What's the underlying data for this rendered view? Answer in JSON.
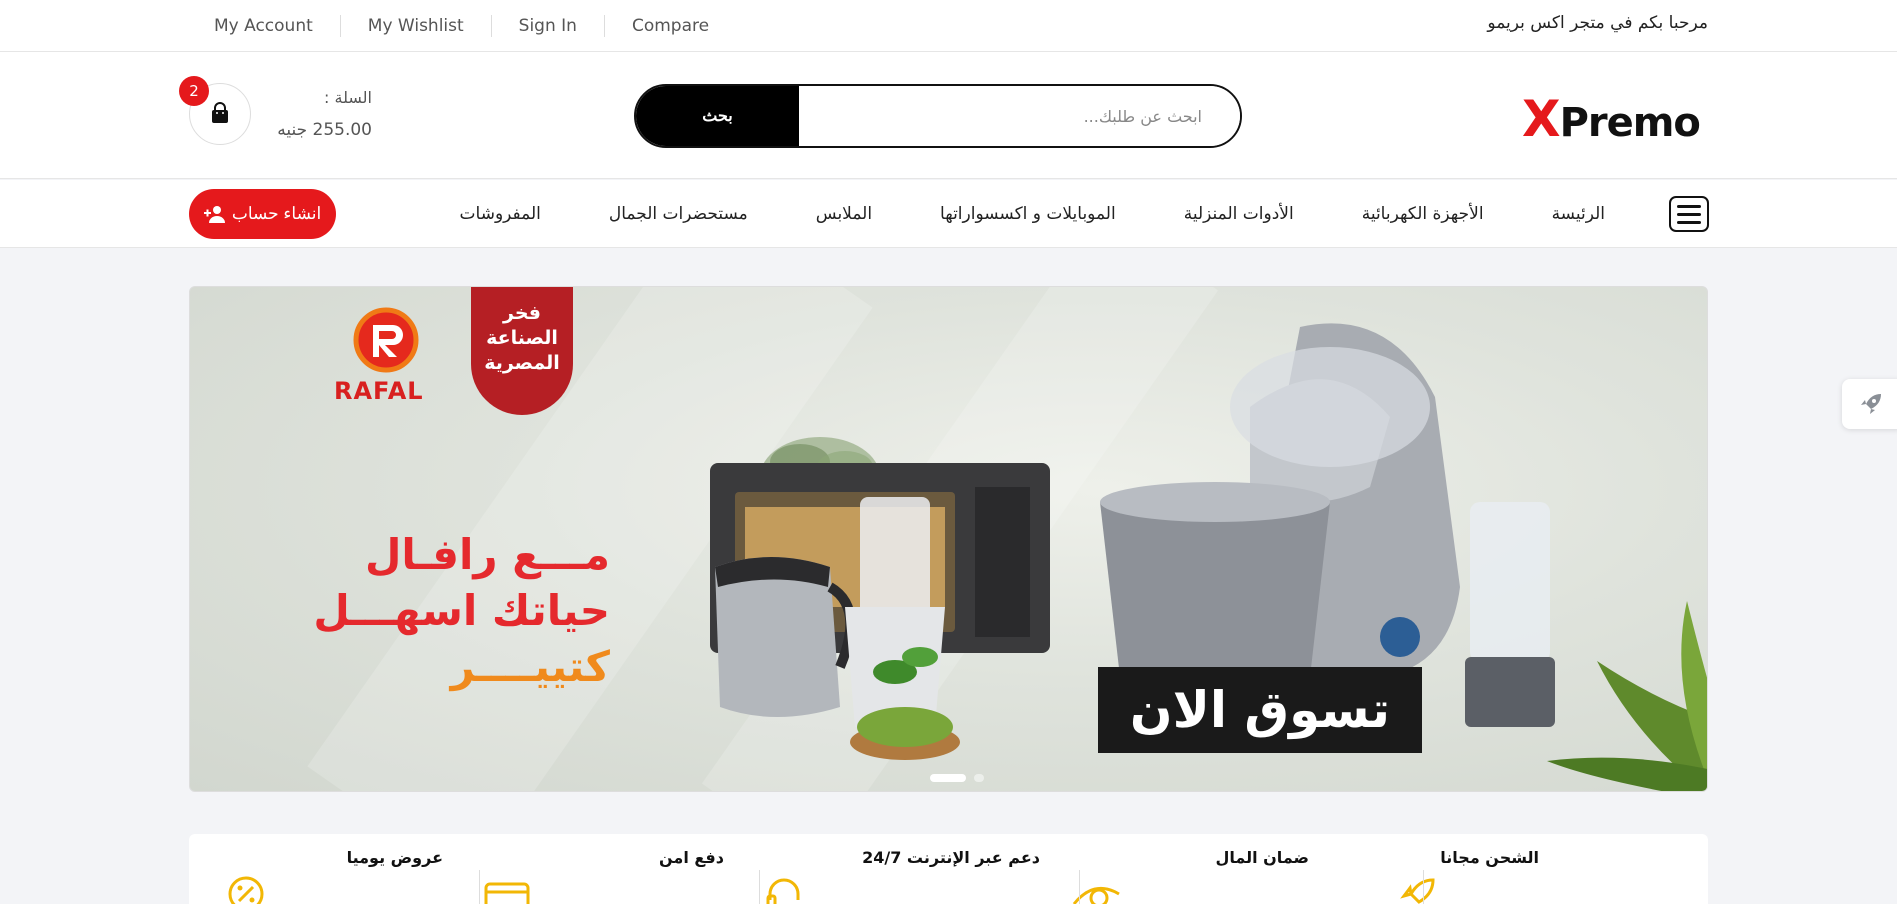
{
  "topbar": {
    "links": [
      "My Account",
      "My Wishlist",
      "Sign In",
      "Compare"
    ],
    "welcome": "مرحبا بكم في متجر اكس بريمو"
  },
  "header": {
    "logo": {
      "x": "X",
      "rest": "Premo"
    },
    "search": {
      "button_label": "بحث",
      "placeholder": "ابحث عن طلبك..."
    },
    "cart": {
      "badge_count": "2",
      "label": "السلة :",
      "total": "255.00 جنيه"
    }
  },
  "nav": {
    "items": [
      "الرئيسة",
      "الأجهزة الكهربائية",
      "الأدوات المنزلية",
      "الموبايلات و اكسسواراتها",
      "الملابس",
      "مستحضرات الجمال",
      "المفروشات"
    ],
    "register_label": "انشاء حساب"
  },
  "banner": {
    "seal_text": [
      "فخر",
      "الصناعة",
      "المصرية"
    ],
    "brand": "RAFAL",
    "slogan": [
      "مـــع رافـال",
      "حياتك اسهـــل",
      "كتييــــر"
    ],
    "cta": "تسوق الان",
    "active_slide": 1,
    "slide_count": 2
  },
  "features": {
    "items": [
      {
        "title": "الشحن مجانا",
        "icon": "rocket-icon"
      },
      {
        "title": "ضمان المال",
        "icon": "money-icon"
      },
      {
        "title": "دعم عبر الإنترنت 24/7",
        "icon": "headset-icon"
      },
      {
        "title": "دفع امن",
        "icon": "card-icon"
      },
      {
        "title": "عروض يوميا",
        "icon": "percent-icon"
      }
    ]
  },
  "colors": {
    "accent": "#e5191c",
    "dark": "#111111",
    "icon_yellow": "#f2b705"
  }
}
